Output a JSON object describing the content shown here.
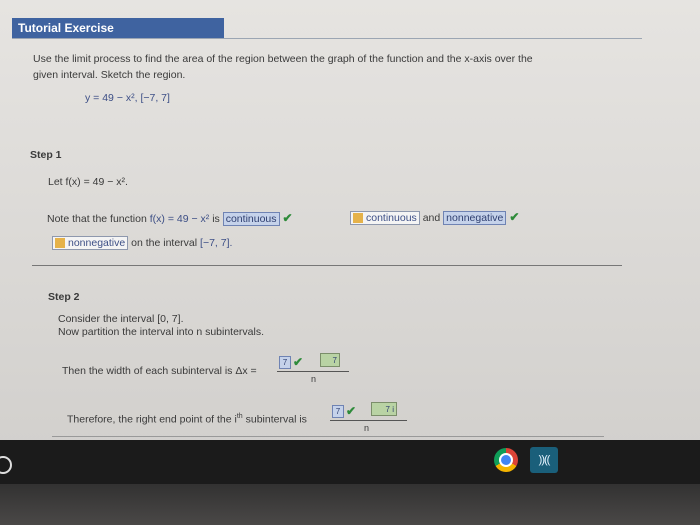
{
  "header": {
    "title": "Tutorial Exercise"
  },
  "problem": {
    "prompt_line1": "Use the limit process to find the area of the region between the graph of the function and the x-axis over the",
    "prompt_line2": "given interval. Sketch the region.",
    "function": "y = 49 − x², [−7, 7]"
  },
  "step1": {
    "title": "Step 1",
    "let_text": "Let f(x) = 49 − x².",
    "note_prefix": "Note that the function",
    "note_math": "f(x) = 49 − x²",
    "is_text": "is",
    "answer1": "continuous",
    "answer2": "continuous",
    "and_text": "and",
    "answer3": "nonnegative",
    "answer4": "nonnegative",
    "interval_text": "on the interval",
    "interval": "[−7, 7]."
  },
  "step2": {
    "title": "Step 2",
    "consider": "Consider the interval [0, 7].",
    "partition": "Now partition the interval into n subintervals.",
    "width_text": "Then the width of each subinterval is Δx =",
    "width_num": "7",
    "width_num2": "7",
    "width_den": "n",
    "right_text": "Therefore, the right end point of the i",
    "right_sup": "th",
    "right_text2": "subinterval is",
    "right_num": "7",
    "right_num2": "7 i",
    "right_den": "n"
  },
  "taskbar": {
    "app_label": "))(("
  }
}
